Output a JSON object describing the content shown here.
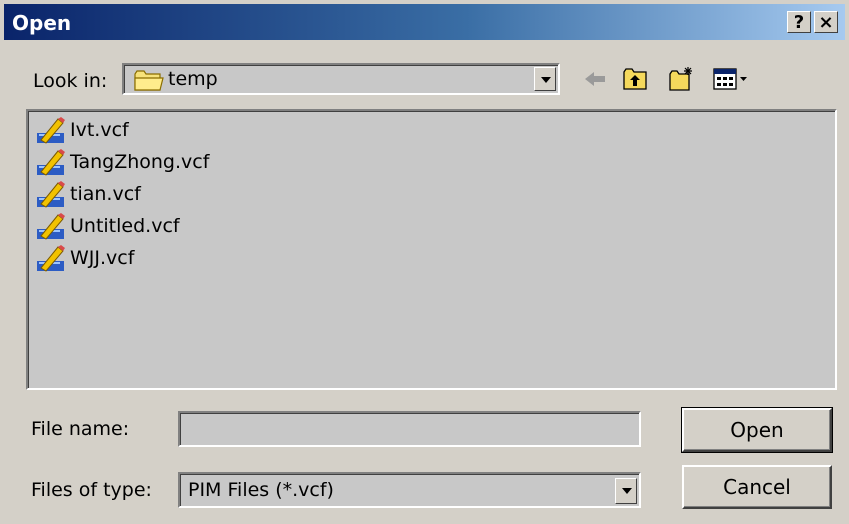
{
  "window": {
    "title": "Open"
  },
  "title_buttons": {
    "help": "?",
    "close": "×"
  },
  "look_in": {
    "label": "Look in:",
    "value": "temp"
  },
  "toolbar": {
    "icons": [
      "back-arrow-icon",
      "up-folder-icon",
      "new-folder-icon",
      "view-menu-icon"
    ]
  },
  "files": [
    {
      "name": "Ivt.vcf"
    },
    {
      "name": "TangZhong.vcf"
    },
    {
      "name": "tian.vcf"
    },
    {
      "name": "Untitled.vcf"
    },
    {
      "name": "WJJ.vcf"
    }
  ],
  "file_name": {
    "label": "File name:",
    "value": ""
  },
  "file_type": {
    "label": "Files of type:",
    "value": "PIM Files (*.vcf)"
  },
  "buttons": {
    "open": "Open",
    "cancel": "Cancel"
  },
  "colors": {
    "title_start": "#0a246a",
    "title_end": "#a6caf0",
    "face": "#d4d0c8",
    "list_bg": "#c8c8c8"
  }
}
